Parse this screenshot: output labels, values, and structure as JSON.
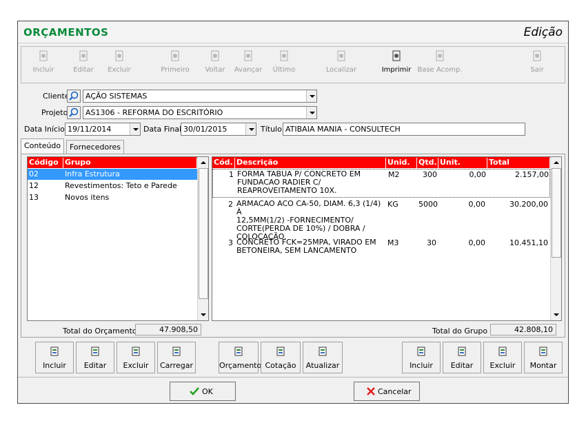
{
  "window": {
    "title": "ORÇAMENTOS",
    "mode": "Edição"
  },
  "toolbar": [
    {
      "label": "Incluir",
      "enabled": false,
      "icon": "add-document-icon"
    },
    {
      "label": "Editar",
      "enabled": false,
      "icon": "edit-document-icon"
    },
    {
      "label": "Excluir",
      "enabled": false,
      "icon": "delete-icon"
    },
    {
      "label": "Primeiro",
      "enabled": false,
      "icon": "first-record-icon"
    },
    {
      "label": "Voltar",
      "enabled": false,
      "icon": "previous-record-icon"
    },
    {
      "label": "Avançar",
      "enabled": false,
      "icon": "next-record-icon"
    },
    {
      "label": "Último",
      "enabled": false,
      "icon": "last-record-icon"
    },
    {
      "label": "Localizar",
      "enabled": false,
      "icon": "search-icon"
    },
    {
      "label": "Imprimir",
      "enabled": true,
      "icon": "print-icon"
    },
    {
      "label": "Base Acomp.",
      "enabled": false,
      "icon": "base-document-icon"
    },
    {
      "label": "Sair",
      "enabled": false,
      "icon": "exit-icon"
    }
  ],
  "form": {
    "cliente_label": "Cliente",
    "cliente_value": "AÇÃO SISTEMAS",
    "projeto_label": "Projeto",
    "projeto_value": "AS1306 - REFORMA DO ESCRITÓRIO",
    "data_inicio_label": "Data Início",
    "data_inicio_value": "19/11/2014",
    "data_final_label": "Data Final",
    "data_final_value": "30/01/2015",
    "titulo_label": "Título",
    "titulo_value": "ATIBAIA MANIA - CONSULTECH"
  },
  "tabs": [
    "Conteúdo",
    "Fornecedores"
  ],
  "groups": {
    "headers": [
      "Código",
      "Grupo"
    ],
    "rows": [
      {
        "codigo": "02",
        "grupo": "Infra Estrutura",
        "selected": true
      },
      {
        "codigo": "12",
        "grupo": "Revestimentos: Teto e Parede",
        "selected": false
      },
      {
        "codigo": "13",
        "grupo": "Novos itens",
        "selected": false
      }
    ],
    "total_label": "Total do Orçamento",
    "total_value": "47.908,50"
  },
  "items": {
    "headers": [
      "Cód.",
      "Descrição",
      "Unid.",
      "Qtd.",
      "Unit.",
      "Total"
    ],
    "rows": [
      {
        "cod": "1",
        "desc": [
          "FORMA TABUA P/ CONCRETO EM",
          "FUNDACAO RADIER C/",
          "REAPROVEITAMENTO 10X."
        ],
        "unid": "M2",
        "qtd": "300",
        "unit": "0,00",
        "total": "2.157,00"
      },
      {
        "cod": "2",
        "desc": [
          "ARMACAO ACO CA-50, DIAM. 6,3 (1/4) À",
          "12,5MM(1/2) -FORNECIMENTO/",
          "CORTE(PERDA DE 10%) / DOBRA /",
          "COLOCAÇÃO."
        ],
        "unid": "KG",
        "qtd": "5000",
        "unit": "0,00",
        "total": "30.200,00"
      },
      {
        "cod": "3",
        "desc": [
          "CONCRETO FCK=25MPA, VIRADO EM",
          "BETONEIRA, SEM LANCAMENTO"
        ],
        "unid": "M3",
        "qtd": "30",
        "unit": "0,00",
        "total": "10.451,10"
      }
    ],
    "total_label": "Total do Grupo",
    "total_value": "42.808,10"
  },
  "group_buttons": [
    "Incluir",
    "Editar",
    "Excluir",
    "Carregar"
  ],
  "middle_buttons": [
    "Orçamento",
    "Cotação",
    "Atualizar"
  ],
  "item_buttons": [
    "Incluir",
    "Editar",
    "Excluir",
    "Montar"
  ],
  "footer": {
    "ok": "OK",
    "cancel": "Cancelar"
  },
  "colors": {
    "title_green": "#0a8a3a",
    "header_red": "#ff0000",
    "selection_blue": "#3399ff"
  }
}
